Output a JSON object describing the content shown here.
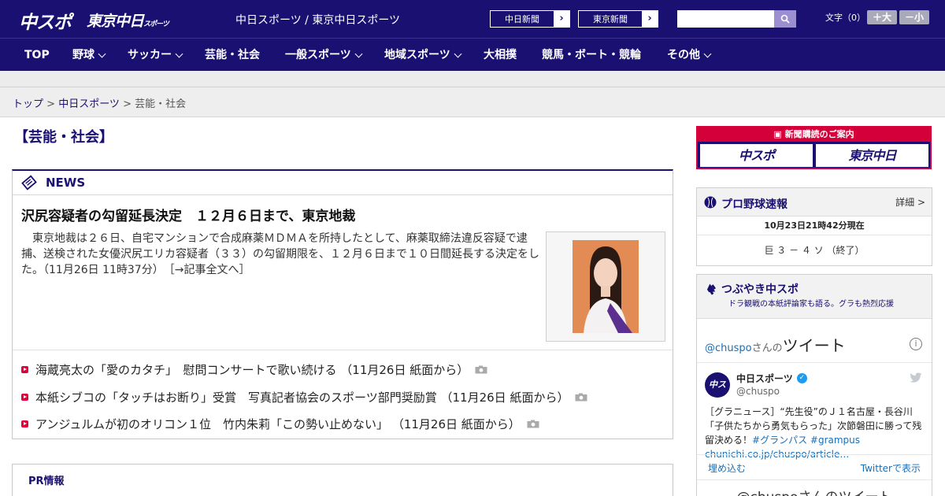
{
  "header": {
    "logo_chuspo": "中スポ",
    "logo_tokyo": "東京中日",
    "logo_tokyo_small": "スポーツ",
    "site_links": "中日スポーツ / 東京中日スポーツ",
    "ext_links": [
      {
        "label": "中日新聞",
        "arrow": "›"
      },
      {
        "label": "東京新聞",
        "arrow": "›"
      }
    ],
    "search": {
      "value": "",
      "placeholder": ""
    },
    "fontsize_label": "文字（0）",
    "fontsize_up": "＋大",
    "fontsize_down": "－小"
  },
  "nav": {
    "items": [
      {
        "label": "TOP"
      },
      {
        "label": "野球"
      },
      {
        "label": "サッカー"
      },
      {
        "label": "芸能・社会"
      },
      {
        "label": "一般スポーツ"
      },
      {
        "label": "地域スポーツ"
      },
      {
        "label": "大相撲"
      },
      {
        "label": "競馬・ボート・競輪"
      },
      {
        "label": "その他"
      }
    ]
  },
  "breadcrumb": {
    "home": "トップ",
    "sep": " > ",
    "level1": "中日スポーツ",
    "current": "芸能・社会"
  },
  "main": {
    "section_title": "【芸能・社会】",
    "news_label": "NEWS",
    "lead": {
      "title": "沢尻容疑者の勾留延長決定　１２月６日まで、東京地裁",
      "body": "東京地裁は２６日、自宅マンションで合成麻薬ＭＤＭＡを所持したとして、麻薬取締法違反容疑で逮捕、送検された女優沢尻エリカ容疑者（３３）の勾留期限を、１２月６日まで１０日間延長する決定をした。（11月26日 11時37分）",
      "more": "［→記事全文へ］"
    },
    "items": [
      {
        "text": "海蔵亮太の「愛のカタチ」　慰問コンサートで歌い続ける",
        "date": "（11月26日 紙面から）"
      },
      {
        "text": "本紙シブコの「タッチはお断り」受賞　写真記者協会のスポーツ部門奨励賞",
        "date": "（11月26日 紙面から）"
      },
      {
        "text": "アンジュルムが初のオリコン１位　竹内朱莉「この勢い止めない」",
        "date": "（11月26日 紙面から）"
      }
    ],
    "pr_label": "PR情報"
  },
  "sidebar": {
    "subscription": {
      "title": "新聞購読のご案内",
      "logo1": "中スポ",
      "logo2": "東京中日"
    },
    "baseball": {
      "title": "プロ野球速報",
      "more": "詳細 >",
      "time": "10月23日21時42分現在",
      "score": "巨 ３ － ４ ソ （終了）"
    },
    "tweets": {
      "title": "つぶやき中スポ",
      "subtitle": "ドラ観戦の本紙評論家も語る。グラも熱烈応援",
      "heading_handle": "@chuspo",
      "heading_san": "さんの",
      "heading_word": "ツイート",
      "info": "i",
      "avatar": "中スポ",
      "name": "中日スポーツ",
      "verified": "✓",
      "handle": "@chuspo",
      "text": "［グラニュース］“先生役”のＪ１名古屋・長谷川「子供たちから勇気もらった」次節磐田に勝って残留決める！",
      "tag1": "#グランパス",
      "tag2": "#grampus",
      "link": "chunichi.co.jp/chuspo/article…",
      "embed": "埋め込む",
      "view": "Twitterで表示",
      "heading2": "@chuspoさんのツイート"
    }
  }
}
